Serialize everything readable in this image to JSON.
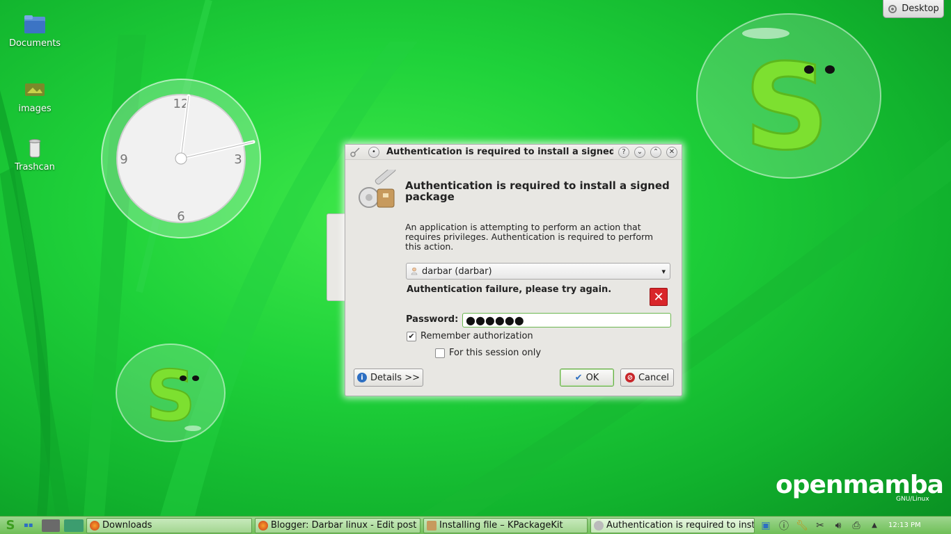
{
  "desktop": {
    "icons": [
      {
        "label": "Documents",
        "icon": "folder-icon"
      },
      {
        "label": "images",
        "icon": "image-folder-icon"
      },
      {
        "label": "Trashcan",
        "icon": "trash-icon"
      }
    ],
    "desktop_button": "Desktop"
  },
  "clock_widget": {
    "numerals": [
      "12",
      "3",
      "6",
      "9"
    ]
  },
  "logo": {
    "brand_open": "open",
    "brand_mamba": "mamba",
    "sub": "GNU/Linux"
  },
  "dialog": {
    "title": "Authentication is required to install a signed...",
    "heading": "Authentication is required to install a signed package",
    "description": "An application is attempting to perform an action that requires privileges. Authentication is required to perform this action.",
    "user_select": "darbar (darbar)",
    "failure": "Authentication failure, please try again.",
    "password_label": "Password:",
    "password_value": "●●●●●●",
    "remember_label": "Remember authorization",
    "remember_checked": true,
    "session_label": "For this session only",
    "session_checked": false,
    "details_button": "Details >>",
    "ok_button": "OK",
    "cancel_button": "Cancel"
  },
  "taskbar": {
    "tasks": [
      {
        "label": "Downloads",
        "icon": "firefox-icon"
      },
      {
        "label": "Blogger: Darbar linux - Edit post ...",
        "icon": "firefox-icon"
      },
      {
        "label": "Installing file – KPackageKit",
        "icon": "package-icon"
      },
      {
        "label": "Authentication is required to inst...",
        "icon": "keys-icon"
      }
    ],
    "clock": "12:13 PM"
  },
  "colors": {
    "background": "#1fd23a",
    "accent_green": "#67ad49",
    "error_red": "#d9262a"
  }
}
